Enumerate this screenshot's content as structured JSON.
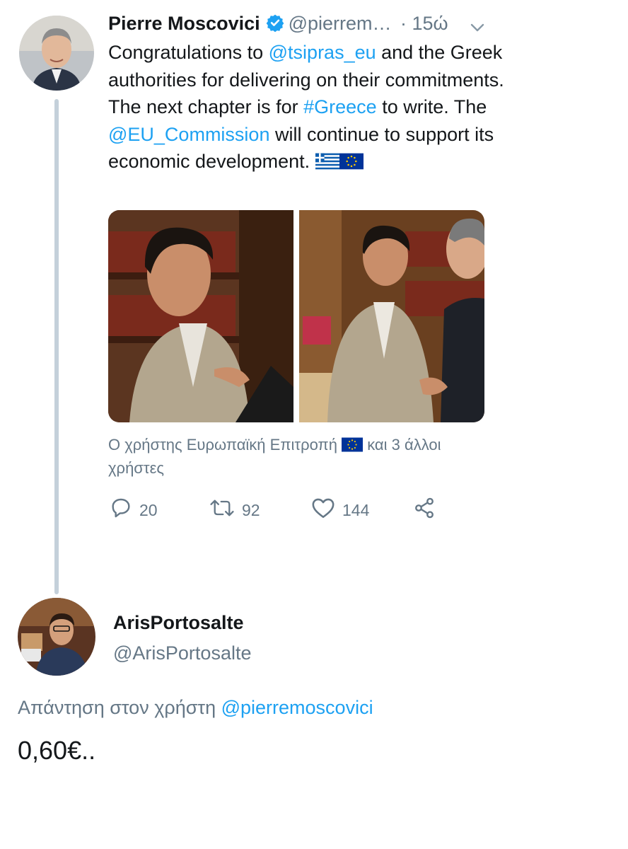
{
  "tweet": {
    "author_name": "Pierre Moscovici",
    "author_handle": "@pierrem…",
    "time": "· 15ώ",
    "text_1": "Congratulations to ",
    "mention_1": "@tsipras_eu",
    "text_2": " and the Greek authorities for delivering on their commitments. The next chapter is for ",
    "hashtag": "#Greece",
    "text_3": " to write. The ",
    "mention_2": "@EU_Commission",
    "text_4": " will continue to support its economic development. ",
    "emoji_flags": [
      "greece-flag",
      "eu-flag"
    ],
    "tagged_prefix": "Ο χρήστης Ευρωπαϊκή Επιτροπή",
    "tagged_suffix": "και 3 άλλοι χρήστες",
    "replies": "20",
    "retweets": "92",
    "likes": "144"
  },
  "reply": {
    "author_name": "ArisPortosalte",
    "author_handle": "@ArisPortosalte",
    "reply_prefix": "Απάντηση στον χρήστη",
    "reply_mention": "@pierremoscovici",
    "text": "0,60€.."
  },
  "colors": {
    "link": "#1da1f2",
    "muted": "#657786",
    "thread_line": "#c4d0da",
    "verified": "#1da1f2"
  }
}
